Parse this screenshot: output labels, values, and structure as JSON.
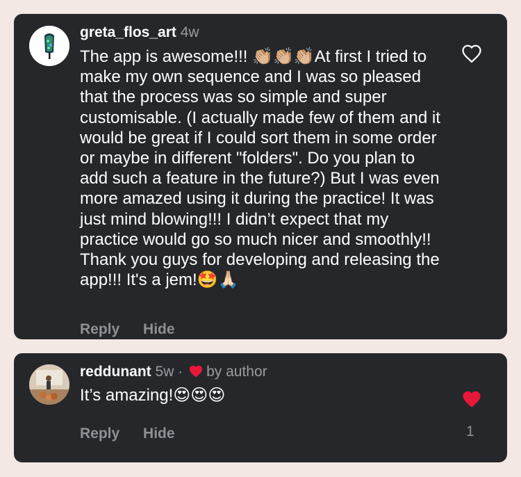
{
  "comments": [
    {
      "username": "greta_flos_art",
      "time": "4w",
      "text": "The app is awesome!!! 👏🏼👏🏼👏🏼At first I tried to make my own sequence and I was so pleased that the process was so simple and super customisable. (I actually made few of them and it would be great if I could sort them in some order or maybe in different \"folders\". Do you plan to add such a feature in the future?) But I was even more amazed using it during the practice! It was just mind blowing!!! I didn’t expect that my practice would go so much nicer and smoothly!! Thank you guys for developing and releasing the app!!! It's a jem!🤩🙏🏻",
      "reply_label": "Reply",
      "hide_label": "Hide",
      "liked": false
    },
    {
      "username": "reddunant",
      "time": "5w",
      "separator": "·",
      "author_note": "by author",
      "text": "It’s amazing!😍😍😍",
      "reply_label": "Reply",
      "hide_label": "Hide",
      "liked": true,
      "like_count": "1"
    }
  ],
  "colors": {
    "page_bg": "#f3e8e3",
    "card_bg": "#25272b",
    "heart_red": "#e8173a",
    "muted_text": "#8d9095"
  }
}
